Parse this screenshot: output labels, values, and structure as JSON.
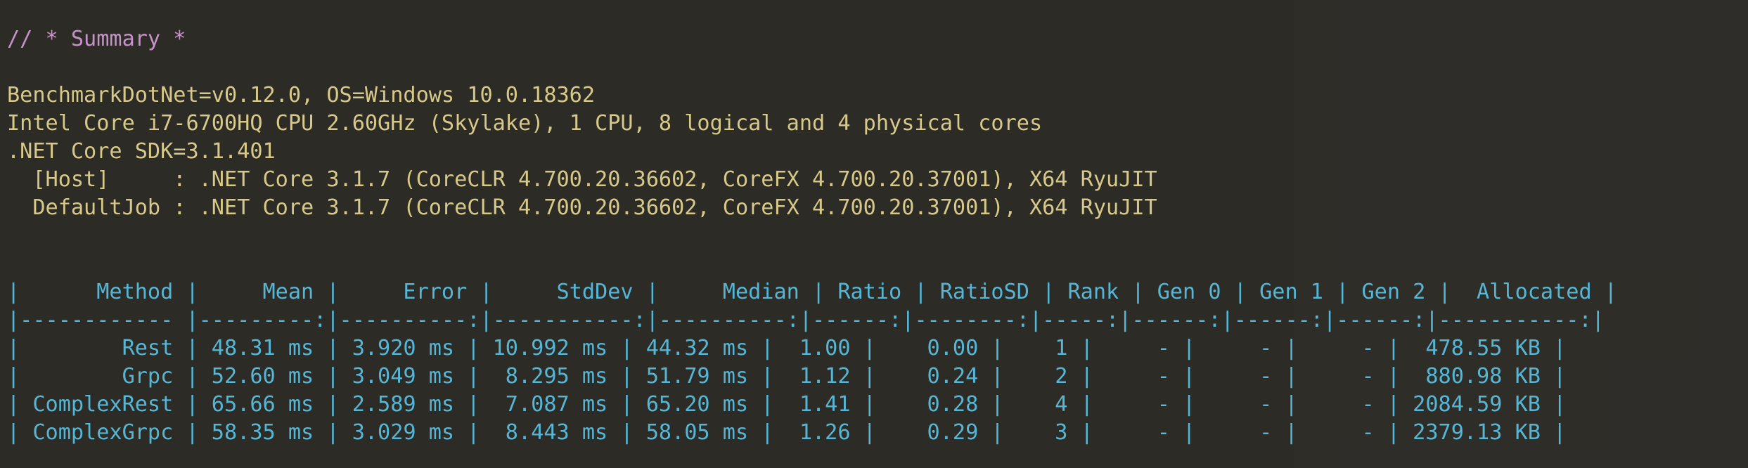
{
  "summary_comment": "// * Summary *",
  "environment": [
    "BenchmarkDotNet=v0.12.0, OS=Windows 10.0.18362",
    "Intel Core i7-6700HQ CPU 2.60GHz (Skylake), 1 CPU, 8 logical and 4 physical cores",
    ".NET Core SDK=3.1.401",
    "  [Host]     : .NET Core 3.1.7 (CoreCLR 4.700.20.36602, CoreFX 4.700.20.37001), X64 RyuJIT",
    "  DefaultJob : .NET Core 3.1.7 (CoreCLR 4.700.20.36602, CoreFX 4.700.20.37001), X64 RyuJIT"
  ],
  "table": {
    "header": "|      Method |     Mean |     Error |     StdDev |     Median | Ratio | RatioSD | Rank | Gen 0 | Gen 1 | Gen 2 |  Allocated |",
    "separator": "|------------ |---------:|----------:|-----------:|----------:|------:|--------:|-----:|------:|------:|------:|-----------:|",
    "rows": [
      "|        Rest | 48.31 ms | 3.920 ms | 10.992 ms | 44.32 ms |  1.00 |    0.00 |    1 |     - |     - |     - |  478.55 KB |",
      "|        Grpc | 52.60 ms | 3.049 ms |  8.295 ms | 51.79 ms |  1.12 |    0.24 |    2 |     - |     - |     - |  880.98 KB |",
      "| ComplexRest | 65.66 ms | 2.589 ms |  7.087 ms | 65.20 ms |  1.41 |    0.28 |    4 |     - |     - |     - | 2084.59 KB |",
      "| ComplexGrpc | 58.35 ms | 3.029 ms |  8.443 ms | 58.05 ms |  1.26 |    0.29 |    3 |     - |     - |     - | 2379.13 KB |"
    ]
  }
}
